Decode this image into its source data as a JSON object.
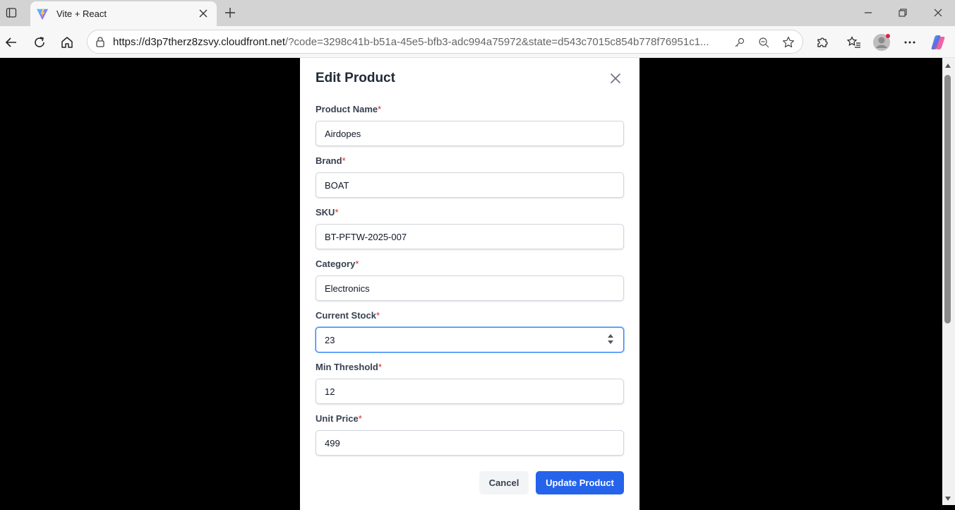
{
  "browser": {
    "tab_title": "Vite + React",
    "url_host": "https://d3p7therz8zsvy.cloudfront.net",
    "url_rest": "/?code=3298c41b-b51a-45e5-bfb3-adc994a75972&state=d543c7015c854b778f76951c1..."
  },
  "modal": {
    "title": "Edit Product",
    "fields": [
      {
        "label": "Product Name",
        "required": "*",
        "value": "Airdopes"
      },
      {
        "label": "Brand",
        "required": "*",
        "value": "BOAT"
      },
      {
        "label": "SKU",
        "required": "*",
        "value": "BT-PFTW-2025-007"
      },
      {
        "label": "Category",
        "required": "*",
        "value": "Electronics"
      },
      {
        "label": "Current Stock",
        "required": "*",
        "value": "23"
      },
      {
        "label": "Min Threshold",
        "required": "*",
        "value": "12"
      },
      {
        "label": "Unit Price",
        "required": "*",
        "value": "499"
      }
    ],
    "cancel_label": "Cancel",
    "update_label": "Update Product"
  },
  "colors": {
    "primary": "#2563eb",
    "required": "#dc2626",
    "focus": "#3b82f6"
  },
  "icons": {
    "favicon": "vite-logo-icon",
    "close": "close-icon",
    "spinner": "number-spinner-icon"
  }
}
